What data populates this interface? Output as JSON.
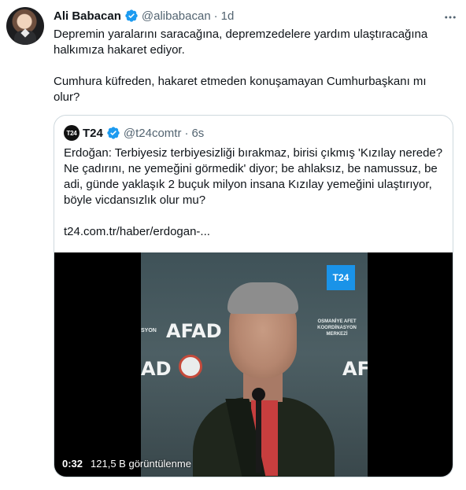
{
  "author": {
    "name": "Ali Babacan",
    "handle": "@alibabacan",
    "separator": "·",
    "time": "1d"
  },
  "tweet": {
    "paragraph1": "Depremin yaralarını saracağına, depremzedelere yardım ulaştıracağına halkımıza hakaret ediyor.",
    "paragraph2": "Cumhura küfreden, hakaret etmeden konuşamayan Cumhurbaşkanı mı olur?"
  },
  "quote": {
    "logo_text": "T24",
    "name": "T24",
    "handle": "@t24comtr",
    "separator": "·",
    "time": "6s",
    "text": "Erdoğan: Terbiyesiz terbiyesizliği bırakmaz, birisi çıkmış 'Kızılay nerede? Ne çadırını, ne yemeğini görmedik' diyor; be ahlaksız, be namussuz, be adi, günde yaklaşık 2 buçuk milyon insana Kızılay yemeğini ulaştırıyor, böyle vicdansızlık olur mu?",
    "link": "t24.com.tr/haber/erdogan-..."
  },
  "video": {
    "duration": "0:32",
    "views": "121,5 B görüntülenme",
    "badge": "T24",
    "wall_logo_1": "AFAD",
    "wall_logo_2": "AD",
    "wall_logo_3": "AFAD",
    "wall_sign": "OSMANİYE AFET KOORDİNASYON MERKEZİ",
    "wall_sign_left": "SYON"
  },
  "colors": {
    "verified": "#1d9bf0",
    "secondary_text": "#536471",
    "border": "#cfd9de",
    "t24_badge": "#1a93e8"
  },
  "icons": {
    "verified": "verified-badge-icon",
    "more": "more-dots-icon"
  }
}
